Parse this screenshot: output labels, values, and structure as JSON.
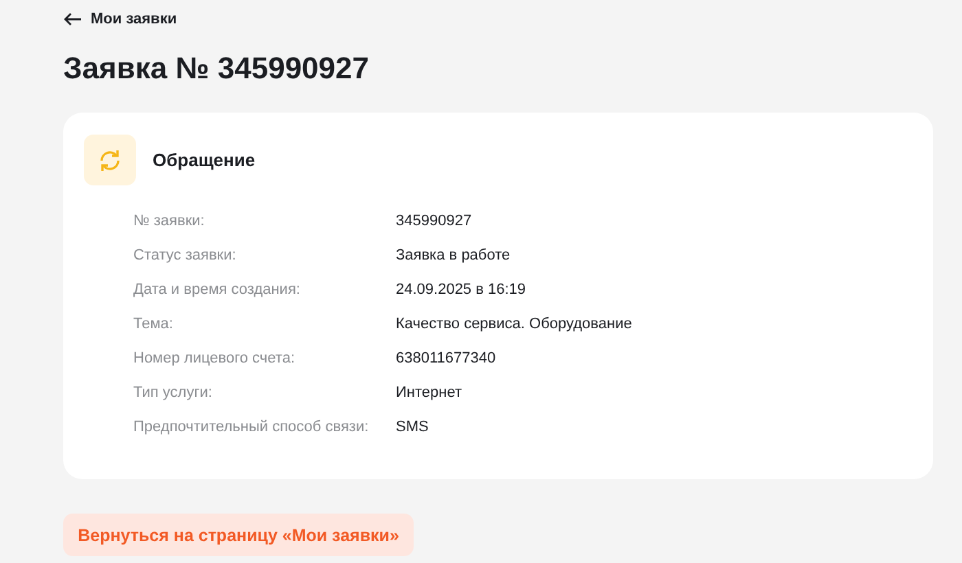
{
  "back_link": {
    "label": "Мои заявки"
  },
  "title": "Заявка № 345990927",
  "card": {
    "heading": "Обращение",
    "fields": [
      {
        "label": "№ заявки:",
        "value": "345990927"
      },
      {
        "label": "Статус заявки:",
        "value": "Заявка в работе"
      },
      {
        "label": "Дата и время создания:",
        "value": "24.09.2025 в 16:19"
      },
      {
        "label": "Тема:",
        "value": "Качество сервиса. Оборудование"
      },
      {
        "label": "Номер лицевого счета:",
        "value": "638011677340"
      },
      {
        "label": "Тип услуги:",
        "value": "Интернет"
      },
      {
        "label": "Предпочтительный способ связи:",
        "value": "SMS"
      }
    ]
  },
  "return_button": "Вернуться на страницу «Мои заявки»"
}
